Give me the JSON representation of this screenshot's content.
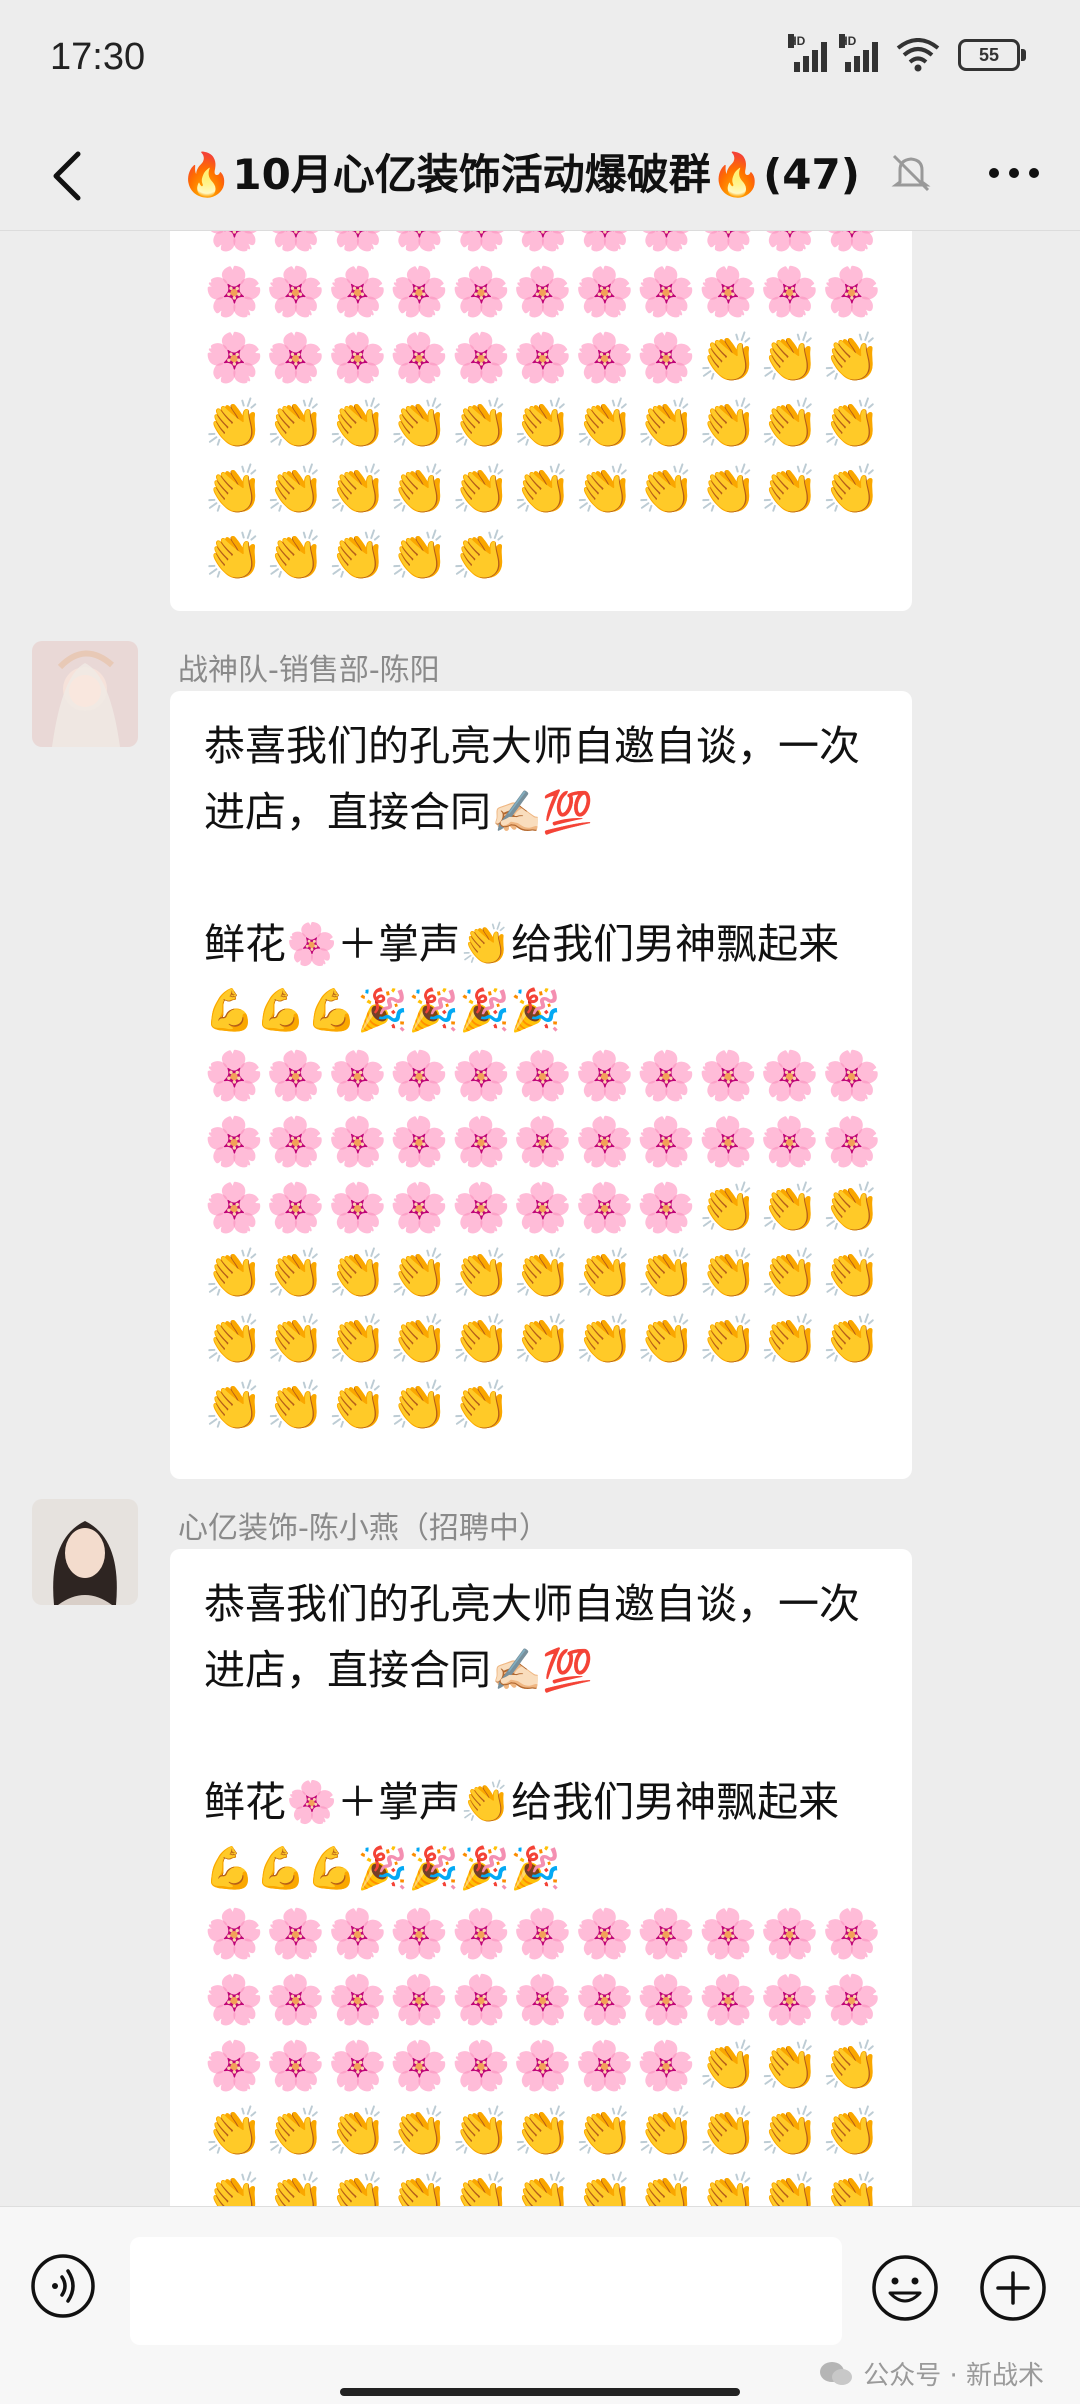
{
  "status": {
    "time": "17:30",
    "battery": "55",
    "signal_label": "HD"
  },
  "header": {
    "title": "🔥10月心亿装饰活动爆破群🔥(47)"
  },
  "messages": [
    {
      "sender": "",
      "rows": [
        "🌸🌸🌸🌸🌸🌸🌸🌸🌸🌸🌸",
        "🌸🌸🌸🌸🌸🌸🌸🌸🌸🌸🌸",
        "🌸🌸🌸🌸🌸🌸🌸🌸👏👏👏",
        "👏👏👏👏👏👏👏👏👏👏👏",
        "👏👏👏👏👏👏👏👏👏👏👏",
        "👏👏👏👏👏"
      ]
    },
    {
      "sender": "战神队-销售部-陈阳",
      "text": "恭喜我们的孔亮大师自邀自谈，一次进店，直接合同✍🏻💯\n\n鲜花🌸＋掌声👏给我们男神飘起来💪💪💪🎉🎉🎉🎉",
      "rows": [
        "🌸🌸🌸🌸🌸🌸🌸🌸🌸🌸🌸",
        "🌸🌸🌸🌸🌸🌸🌸🌸🌸🌸🌸",
        "🌸🌸🌸🌸🌸🌸🌸🌸👏👏👏",
        "👏👏👏👏👏👏👏👏👏👏👏",
        "👏👏👏👏👏👏👏👏👏👏👏",
        "👏👏👏👏👏"
      ]
    },
    {
      "sender": "心亿装饰-陈小燕（招聘中）",
      "text": "恭喜我们的孔亮大师自邀自谈，一次进店，直接合同✍🏻💯\n\n鲜花🌸＋掌声👏给我们男神飘起来💪💪💪🎉🎉🎉🎉",
      "rows": [
        "🌸🌸🌸🌸🌸🌸🌸🌸🌸🌸🌸",
        "🌸🌸🌸🌸🌸🌸🌸🌸🌸🌸🌸",
        "🌸🌸🌸🌸🌸🌸🌸🌸👏👏👏",
        "👏👏👏👏👏👏👏👏👏👏👏",
        "👏👏👏👏👏👏👏👏👏👏👏"
      ]
    }
  ],
  "footer": {
    "watermark": "公众号 · 新战术"
  },
  "colors": {
    "background": "#ededed",
    "bubble": "#ffffff",
    "sender": "#8a8a8a"
  }
}
